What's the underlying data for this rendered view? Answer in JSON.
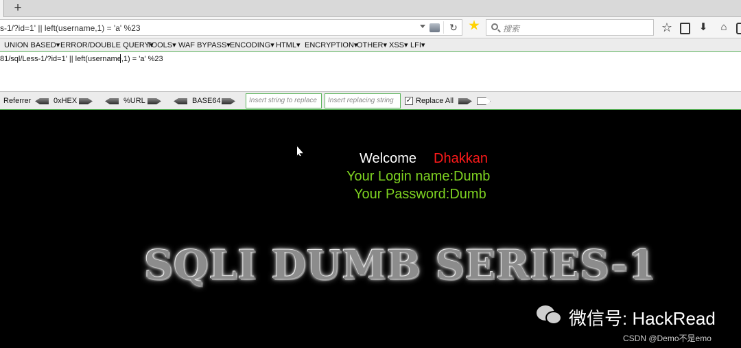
{
  "tabbar": {
    "new_tab_label": "+"
  },
  "navbar": {
    "url": "s-1/?id=1' || left(username,1) = 'a' %23",
    "search_placeholder": "搜索"
  },
  "hackbar": {
    "menu": [
      "UNION BASED",
      "ERROR/DOUBLE QUERY",
      "TOOLS",
      "WAF BYPASS",
      "ENCODING",
      "HTML",
      "ENCRYPTION",
      "OTHER",
      "XSS",
      "LFI"
    ],
    "textarea_value": "81/sql/Less-1/?id=1' || left(username,1) = 'a' %23",
    "referrer_label": "Referrer",
    "hex_label": "0xHEX",
    "url_label": "%URL",
    "base64_label": "BASE64",
    "replace_placeholder": "Insert string to replace",
    "replacing_placeholder": "Insert replacing string",
    "replace_all_label": "Replace All",
    "replace_all_checked": true
  },
  "page": {
    "welcome": "Welcome",
    "username": "Dhakkan",
    "login_line": "Your Login name:Dumb",
    "password_line": "Your Password:Dumb",
    "banner": "SQLI DUMB SERIES-1"
  },
  "watermark": {
    "wechat": "微信号: HackRead",
    "csdn": "CSDN @Demo不是emo"
  },
  "colors": {
    "welcome": "#ffffff",
    "username": "#ff1a1a",
    "credentials": "#7ed321",
    "hackbar_border": "#59b359"
  },
  "icons": [
    "new-tab-icon",
    "dropdown-arrow-icon",
    "site-info-icon",
    "reload-icon",
    "star-icon",
    "search-icon",
    "bookmark-star-icon",
    "reading-list-icon",
    "download-icon",
    "home-icon",
    "extension-icon",
    "left-arrow-icon",
    "right-arrow-icon",
    "checkbox-icon",
    "mouse-pointer-icon",
    "wechat-icon"
  ]
}
